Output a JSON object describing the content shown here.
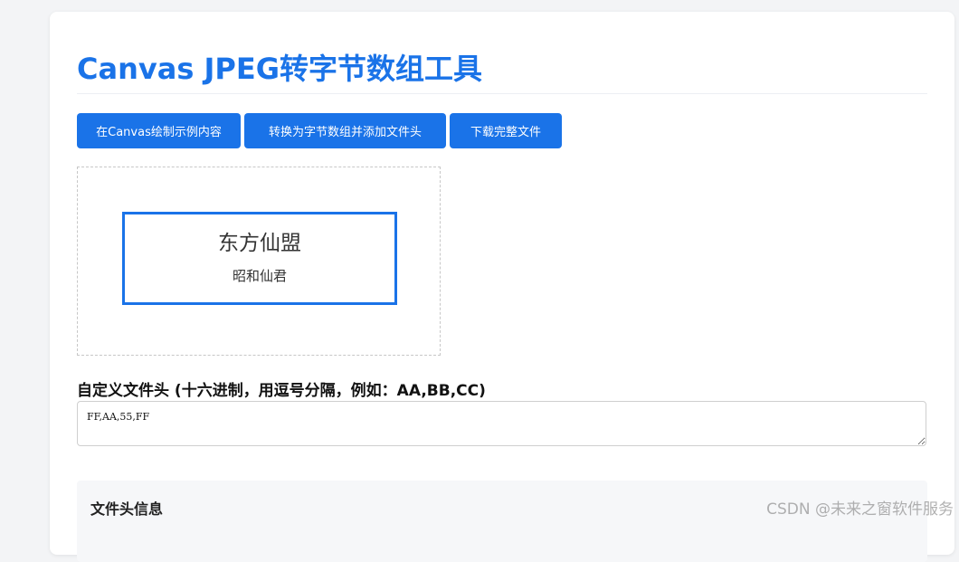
{
  "page": {
    "title": "Canvas JPEG转字节数组工具"
  },
  "toolbar": {
    "draw_label": "在Canvas绘制示例内容",
    "convert_label": "转换为字节数组并添加文件头",
    "download_label": "下载完整文件"
  },
  "canvas": {
    "main_text": "东方仙盟",
    "sub_text": "昭和仙君",
    "border_color": "#1a73e8"
  },
  "header_field": {
    "label": "自定义文件头 (十六进制，用逗号分隔，例如：AA,BB,CC)",
    "value": "FF,AA,55,FF"
  },
  "info": {
    "title": "文件头信息"
  },
  "watermark": {
    "text": "CSDN @未来之窗软件服务"
  },
  "colors": {
    "accent": "#1a73e8"
  }
}
